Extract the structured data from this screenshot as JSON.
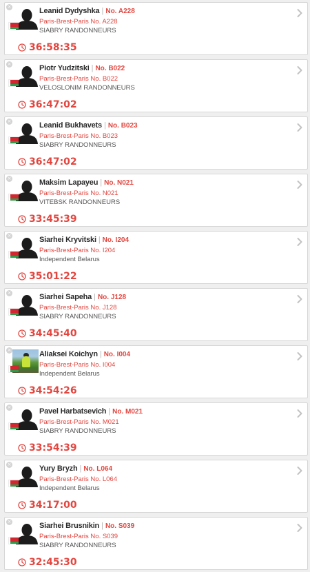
{
  "riders": [
    {
      "name": "Leanid Dydyshka",
      "bib": "No. A228",
      "event": "Paris-Brest-Paris No. A228",
      "club": "SIABRY RANDONNEURS",
      "time": "36:58:35",
      "avatar": "default-avatar-icon"
    },
    {
      "name": "Piotr Yudzitski",
      "bib": "No. B022",
      "event": "Paris-Brest-Paris No. B022",
      "club": "VELOSLONIM RANDONNEURS",
      "time": "36:47:02",
      "avatar": "default-avatar-icon"
    },
    {
      "name": "Leanid Bukhavets",
      "bib": "No. B023",
      "event": "Paris-Brest-Paris No. B023",
      "club": "SIABRY RANDONNEURS",
      "time": "36:47:02",
      "avatar": "default-avatar-icon"
    },
    {
      "name": "Maksim Lapayeu",
      "bib": "No. N021",
      "event": "Paris-Brest-Paris No. N021",
      "club": "VITEBSK RANDONNEURS",
      "time": "33:45:39",
      "avatar": "default-avatar-icon"
    },
    {
      "name": "Siarhei Kryvitski",
      "bib": "No. I204",
      "event": "Paris-Brest-Paris No. I204",
      "club": "Independent Belarus",
      "time": "35:01:22",
      "avatar": "default-avatar-icon"
    },
    {
      "name": "Siarhei Sapeha",
      "bib": "No. J128",
      "event": "Paris-Brest-Paris No. J128",
      "club": "SIABRY RANDONNEURS",
      "time": "34:45:40",
      "avatar": "default-avatar-icon"
    },
    {
      "name": "Aliaksei Koichyn",
      "bib": "No. I004",
      "event": "Paris-Brest-Paris No. I004",
      "club": "Independent Belarus",
      "time": "34:54:26",
      "avatar": "photo-avatar"
    },
    {
      "name": "Pavel Harbatsevich",
      "bib": "No. M021",
      "event": "Paris-Brest-Paris No. M021",
      "club": "SIABRY RANDONNEURS",
      "time": "33:54:39",
      "avatar": "default-avatar-icon"
    },
    {
      "name": "Yury Bryzh",
      "bib": "No. L064",
      "event": "Paris-Brest-Paris No. L064",
      "club": "Independent Belarus",
      "time": "34:17:00",
      "avatar": "default-avatar-icon"
    },
    {
      "name": "Siarhei Brusnikin",
      "bib": "No. S039",
      "event": "Paris-Brest-Paris No. S039",
      "club": "SIABRY RANDONNEURS",
      "time": "32:45:30",
      "avatar": "default-avatar-icon"
    }
  ],
  "icons": {
    "remove": "close-icon",
    "country_flag": "belarus-flag-icon",
    "finish_time": "clock-icon",
    "open_details": "chevron-right-icon"
  },
  "colors": {
    "accent": "#e2463f",
    "card_background": "#ffffff",
    "page_background": "#efefef",
    "text": "#2b2b2b",
    "muted_text": "#555555",
    "flag_red": "#d22730",
    "flag_green": "#2e9b4a"
  }
}
